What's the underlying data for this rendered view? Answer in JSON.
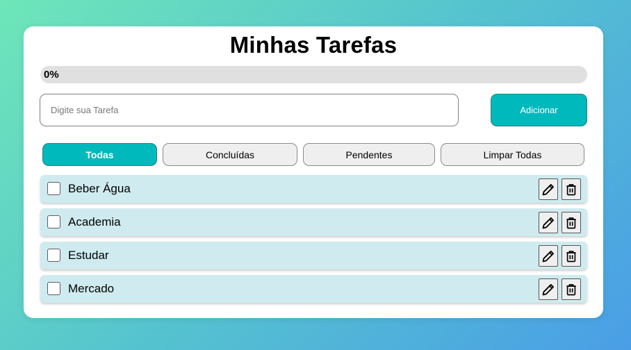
{
  "app": {
    "title": "Minhas Tarefas"
  },
  "progress": {
    "label": "0%",
    "value": 0
  },
  "input": {
    "placeholder": "Digite sua Tarefa",
    "value": ""
  },
  "add_button": {
    "label": "Adicionar"
  },
  "filters": [
    {
      "label": "Todas",
      "active": true
    },
    {
      "label": "Concluídas",
      "active": false
    },
    {
      "label": "Pendentes",
      "active": false
    },
    {
      "label": "Limpar Todas",
      "active": false
    }
  ],
  "tasks": [
    {
      "label": "Beber Água",
      "done": false
    },
    {
      "label": "Academia",
      "done": false
    },
    {
      "label": "Estudar",
      "done": false
    },
    {
      "label": "Mercado",
      "done": false
    }
  ],
  "icons": {
    "edit": "pencil-icon",
    "delete": "trash-icon"
  },
  "colors": {
    "accent": "#00b9bd",
    "task_bg": "#cfebef",
    "progress_track": "#e0e0e0"
  }
}
